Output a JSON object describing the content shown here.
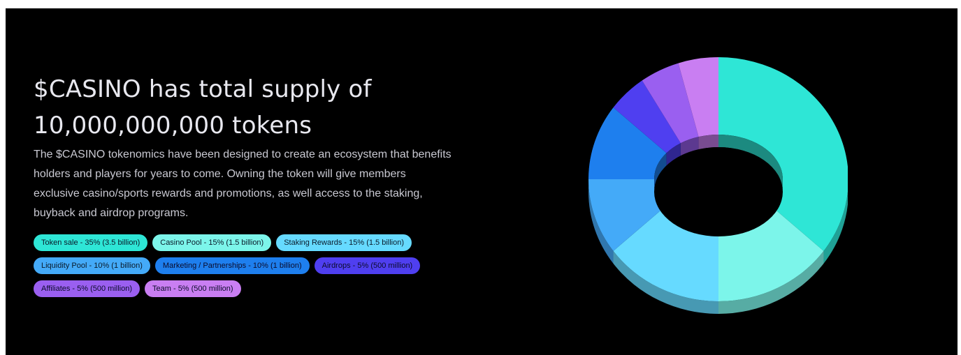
{
  "headline": {
    "line1": "$CASINO has total supply of",
    "line2": "10,000,000,000 tokens"
  },
  "description": "The $CASINO tokenomics have been designed to create an ecosystem that benefits holders and players for years to come. Owning the token will give members exclusive casino/sports rewards and promotions, as well access to the staking, buyback and airdrop programs.",
  "tags": [
    [
      "Token sale - 35% (3.5 billion)",
      "Casino Pool - 15% (1.5 billion)",
      "Staking Rewards - 15% (1.5 billion)"
    ],
    [
      "Liquidity Pool - 10% (1 billion)",
      "Marketing / Partnerships - 10% (1 billion)",
      "Airdrops - 5% (500 million)"
    ],
    [
      "Affiliates - 5% (500 million)",
      "Team - 5% (500 million)"
    ]
  ],
  "chart_data": {
    "type": "pie",
    "style": "3d-donut",
    "categories": [
      "Token sale",
      "Casino Pool",
      "Staking Rewards",
      "Liquidity Pool",
      "Marketing / Partnerships",
      "Airdrops",
      "Affiliates",
      "Team"
    ],
    "values": [
      35,
      15,
      15,
      10,
      10,
      5,
      5,
      5
    ],
    "unit": "%",
    "colors": [
      "#2ee6d6",
      "#7cf5ea",
      "#66daff",
      "#44aaf8",
      "#1e7fee",
      "#4f3ff0",
      "#9a5ff0",
      "#c97ef2"
    ],
    "title": ""
  }
}
